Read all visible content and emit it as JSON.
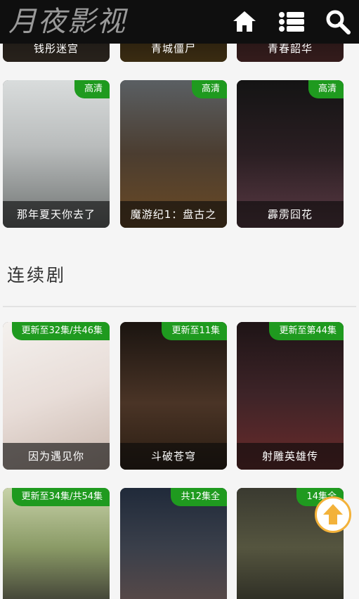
{
  "header": {
    "logo": "月夜影视",
    "icons": [
      "home-icon",
      "list-icon",
      "search-icon"
    ]
  },
  "top_row": [
    {
      "title": "钱彤迷宫"
    },
    {
      "title": "青城僵尸"
    },
    {
      "title": "青春韶华"
    }
  ],
  "movies": [
    {
      "title": "那年夏天你去了",
      "badge": "高清"
    },
    {
      "title": "魔游纪1：盘古之",
      "badge": "高清"
    },
    {
      "title": "霹雳囧花",
      "badge": "高清"
    }
  ],
  "series_section": {
    "title": "连续剧"
  },
  "series": [
    {
      "title": "因为遇见你",
      "badge": "更新至32集/共46集"
    },
    {
      "title": "斗破苍穹",
      "badge": "更新至11集"
    },
    {
      "title": "射雕英雄传",
      "badge": "更新至第44集"
    },
    {
      "title": "",
      "badge": "更新至34集/共54集"
    },
    {
      "title": "",
      "badge": "共12集全"
    },
    {
      "title": "",
      "badge": "14集全"
    }
  ],
  "colors": {
    "header_bg": "#0f0f0f",
    "badge_green": "#1f9a1f",
    "fab_accent": "#f3b23a"
  }
}
